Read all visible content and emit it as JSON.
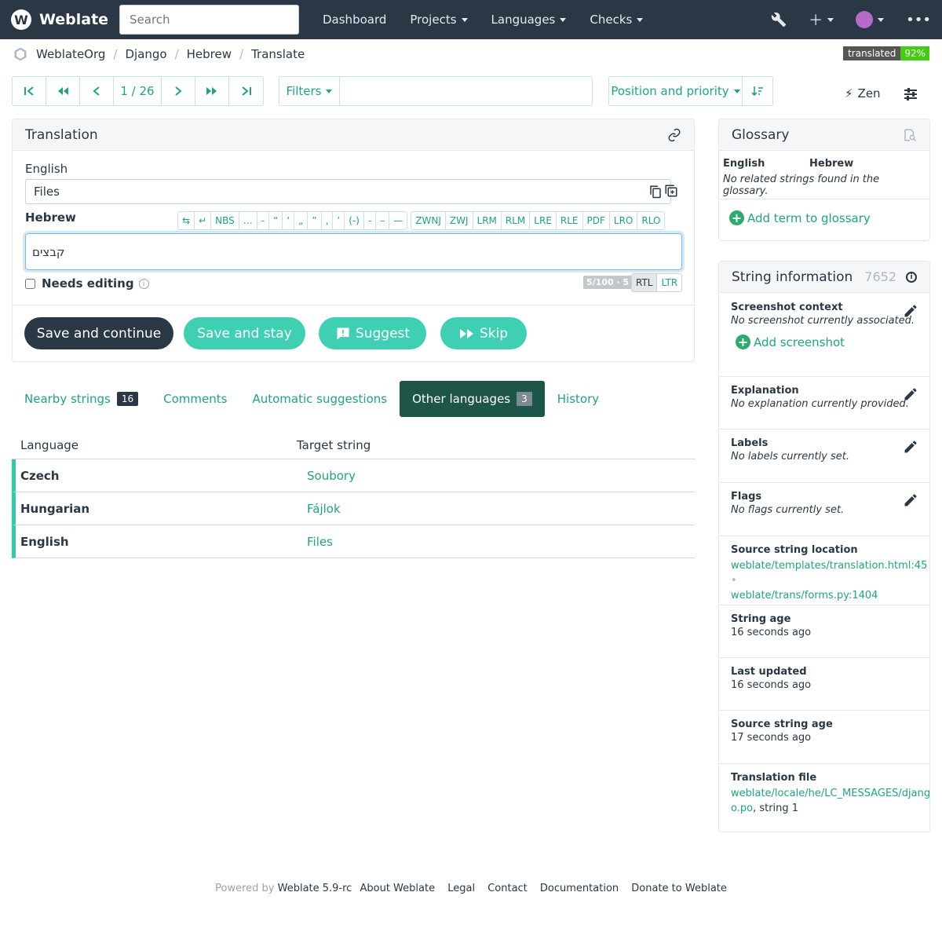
{
  "navbar": {
    "brand": "Weblate",
    "search_placeholder": "Search",
    "links": [
      "Dashboard",
      "Projects",
      "Languages",
      "Checks"
    ]
  },
  "breadcrumb": [
    "WeblateOrg",
    "Django",
    "Hebrew",
    "Translate"
  ],
  "badge": {
    "label": "translated",
    "value": "92%"
  },
  "pager": {
    "position": "1 / 26"
  },
  "filters": {
    "label": "Filters",
    "query": ""
  },
  "sort": {
    "label": "Position and priority"
  },
  "zen": "Zen",
  "translation": {
    "title": "Translation",
    "source_lang": "English",
    "source_text": "Files",
    "target_lang": "Hebrew",
    "target_text": "קבצים",
    "special_chars_1": [
      "⇆",
      "↵",
      "NBS",
      "…",
      "-",
      "“",
      "‘",
      "„",
      "”",
      "‚",
      "’",
      "(-)",
      "-",
      "–",
      "—"
    ],
    "special_chars_2": [
      "ZWNJ",
      "ZWJ",
      "LRM",
      "RLM",
      "LRE",
      "RLE",
      "PDF",
      "LRO",
      "RLO"
    ],
    "needs_editing": "Needs editing",
    "counter": "5/100 · 5",
    "rtl": "RTL",
    "ltr": "LTR",
    "buttons": {
      "save_continue": "Save and continue",
      "save_stay": "Save and stay",
      "suggest": "Suggest",
      "skip": "Skip"
    }
  },
  "tabs": [
    {
      "label": "Nearby strings",
      "count": "16"
    },
    {
      "label": "Comments"
    },
    {
      "label": "Automatic suggestions"
    },
    {
      "label": "Other languages",
      "count": "3"
    },
    {
      "label": "History"
    }
  ],
  "other_languages": {
    "headers": [
      "Language",
      "Target string"
    ],
    "rows": [
      {
        "language": "Czech",
        "target": "Soubory"
      },
      {
        "language": "Hungarian",
        "target": "Fájlok"
      },
      {
        "language": "English",
        "target": "Files"
      }
    ]
  },
  "glossary": {
    "title": "Glossary",
    "col_source": "English",
    "col_target": "Hebrew",
    "empty": "No related strings found in the glossary.",
    "add": "Add term to glossary"
  },
  "string_info": {
    "title": "String information",
    "id": "7652",
    "screenshot_title": "Screenshot context",
    "screenshot_value": "No screenshot currently associated.",
    "add_screenshot": "Add screenshot",
    "explanation_title": "Explanation",
    "explanation_value": "No explanation currently provided.",
    "labels_title": "Labels",
    "labels_value": "No labels currently set.",
    "flags_title": "Flags",
    "flags_value": "No flags currently set.",
    "location_title": "Source string location",
    "location_1": "weblate/templates/translation.html:45",
    "location_sep": "•",
    "location_2": "weblate/trans/forms.py:1404",
    "age_title": "String age",
    "age_value": "16 seconds ago",
    "updated_title": "Last updated",
    "updated_value": "16 seconds ago",
    "source_age_title": "Source string age",
    "source_age_value": "17 seconds ago",
    "file_title": "Translation file",
    "file_link_1": "weblate/locale/he/LC_MESSAGES/djang",
    "file_link_2": "o.po",
    "file_suffix": ", string 1"
  },
  "footer": {
    "powered": "Powered by",
    "version": "Weblate 5.9-rc",
    "links": [
      "About Weblate",
      "Legal",
      "Contact",
      "Documentation",
      "Donate to Weblate"
    ]
  }
}
